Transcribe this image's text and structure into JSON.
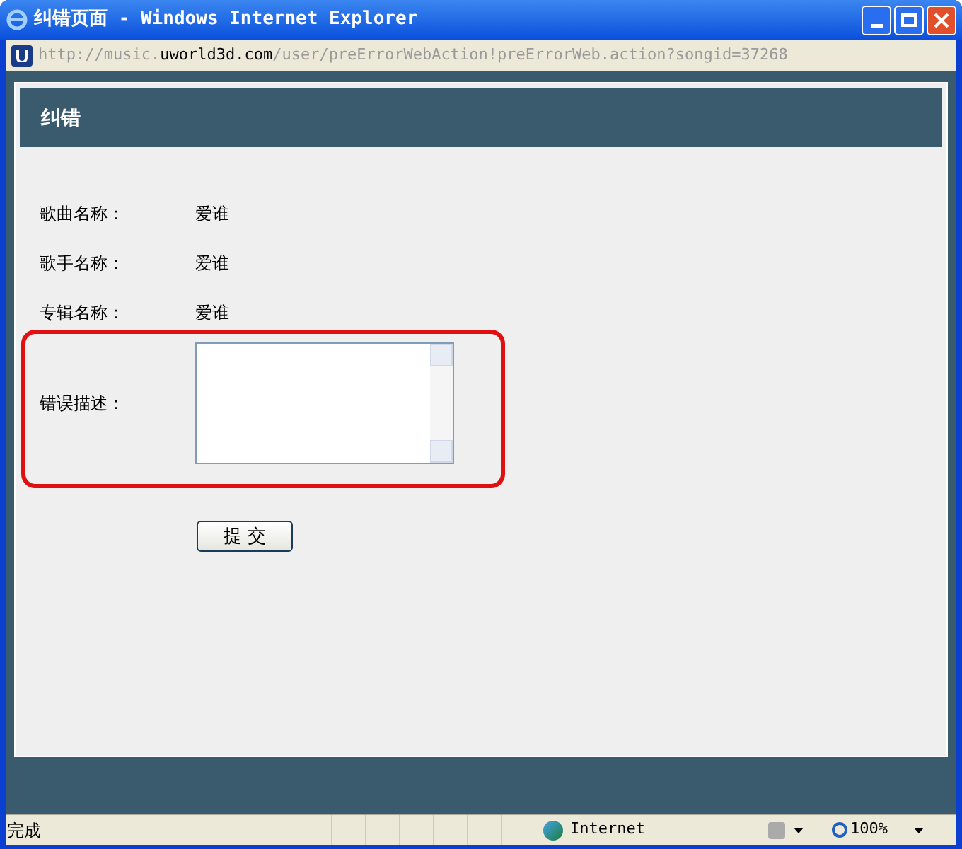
{
  "window": {
    "title": "纠错页面 - Windows Internet Explorer"
  },
  "address_bar": {
    "url": "http://music.**uworld3d.com**/user/preErrorWebAction!preErrorWeb.action?songid=37268"
  },
  "page": {
    "header": "纠错",
    "fields": [
      {
        "label": "歌曲名称：",
        "value": "爱谁"
      },
      {
        "label": "歌手名称：",
        "value": "爱谁"
      },
      {
        "label": "专辑名称：",
        "value": "爱谁"
      }
    ],
    "description": {
      "label": "错误描述：",
      "highlighted": true
    },
    "submit": "提 交"
  },
  "status_bar": {
    "status": "完成",
    "zone": "Internet",
    "zoom": "100%"
  }
}
